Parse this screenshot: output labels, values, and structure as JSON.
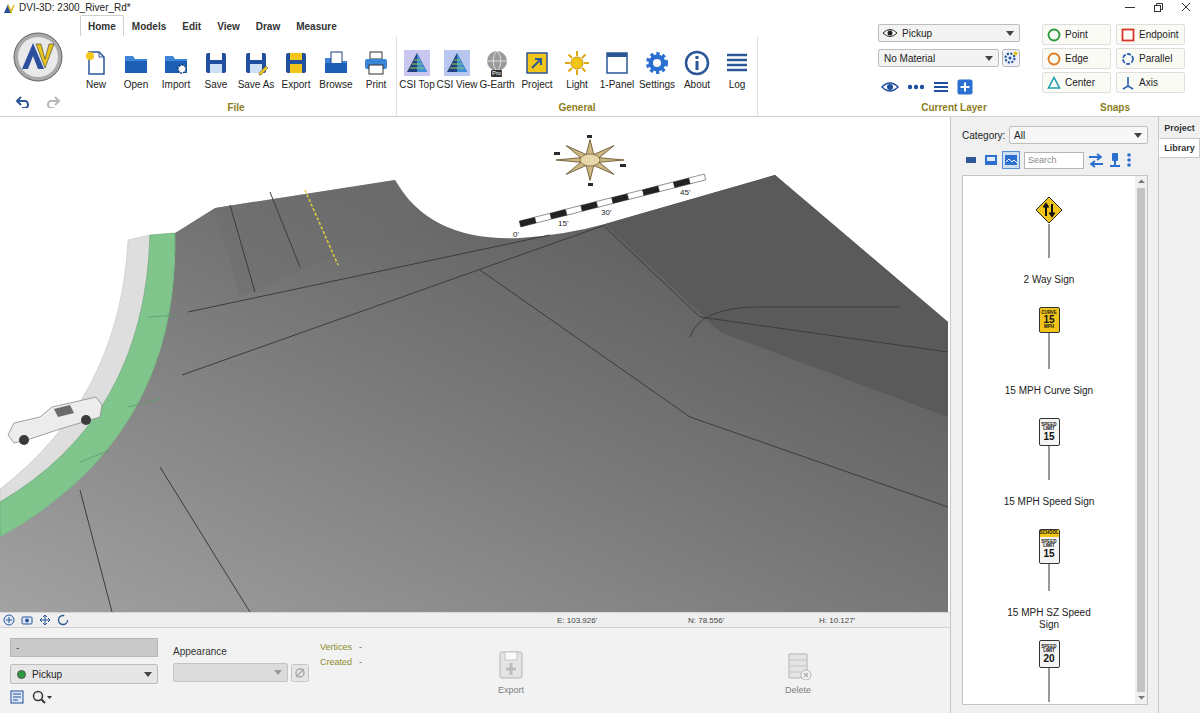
{
  "window": {
    "title": "DVI-3D: 2300_River_Rd*"
  },
  "ribbon": {
    "tabs": [
      {
        "label": "Home",
        "selected": true
      },
      {
        "label": "Models",
        "selected": false
      },
      {
        "label": "Edit",
        "selected": false
      },
      {
        "label": "View",
        "selected": false
      },
      {
        "label": "Draw",
        "selected": false
      },
      {
        "label": "Measure",
        "selected": false
      }
    ],
    "groups": [
      {
        "label": "File",
        "buttons": [
          {
            "label": "New"
          },
          {
            "label": "Open"
          },
          {
            "label": "Import"
          },
          {
            "label": "Save"
          },
          {
            "label": "Save As"
          },
          {
            "label": "Export"
          },
          {
            "label": "Browse"
          },
          {
            "label": "Print"
          }
        ]
      },
      {
        "label": "General",
        "buttons": [
          {
            "label": "CSI Top"
          },
          {
            "label": "CSI View"
          },
          {
            "label": "G-Earth",
            "badge": "Pro"
          },
          {
            "label": "Project"
          },
          {
            "label": "Light"
          },
          {
            "label": "1-Panel"
          },
          {
            "label": "Settings"
          },
          {
            "label": "About"
          },
          {
            "label": "Log"
          }
        ]
      }
    ],
    "undo_enabled": true,
    "redo_enabled": false
  },
  "current_layer": {
    "label": "Current Layer",
    "layer": "Pickup",
    "material": "No Material"
  },
  "snaps": {
    "label": "Snaps",
    "items": [
      {
        "label": "Point",
        "kind": "circle",
        "color": "#2a9a3c"
      },
      {
        "label": "Endpoint",
        "kind": "square",
        "color": "#d9362b"
      },
      {
        "label": "Edge",
        "kind": "circle",
        "color": "#e07a1f"
      },
      {
        "label": "Parallel",
        "kind": "ring",
        "color": "#2d5fb5"
      },
      {
        "label": "Center",
        "kind": "triangle",
        "color": "#1f9fb0"
      },
      {
        "label": "Axis",
        "kind": "axis",
        "color": "#2d5fb5"
      }
    ]
  },
  "viewport": {
    "scale_labels": [
      "0'",
      "15'",
      "30'",
      "45'"
    ],
    "coords": [
      {
        "text": "E: 103.926'"
      },
      {
        "text": "N: 78.556'"
      },
      {
        "text": "H: 10.127'"
      }
    ]
  },
  "properties": {
    "name_field": "-",
    "name_disabled": true,
    "layer": "Pickup",
    "layer_color": "#2a9a3c",
    "appearance_label": "Appearance",
    "appearance_disabled": true,
    "stats": [
      {
        "label": "Vertices",
        "value": "-"
      },
      {
        "label": "Created",
        "value": "-"
      }
    ],
    "actions": [
      {
        "label": "Export",
        "disabled": true
      },
      {
        "label": "Delete",
        "disabled": true
      }
    ]
  },
  "library": {
    "tabs": [
      {
        "label": "Project",
        "selected": false
      },
      {
        "label": "Library",
        "selected": true
      }
    ],
    "category_label": "Category:",
    "category": "All",
    "search_placeholder": "Search",
    "view_buttons": [
      {
        "selected": false
      },
      {
        "selected": false
      },
      {
        "selected": true
      }
    ],
    "items": [
      {
        "name": "2 Way Sign",
        "kind": "warning"
      },
      {
        "name": "15 MPH Curve Sign",
        "kind": "advisory",
        "sign": [
          "CURVE",
          "15",
          "MPH"
        ]
      },
      {
        "name": "15 MPH Speed Sign",
        "kind": "speed",
        "sign": [
          "SPEED",
          "LIMIT",
          "15"
        ]
      },
      {
        "name": "15 MPH SZ Speed Sign",
        "kind": "school",
        "sign": [
          "SCHOOL",
          "SPEED",
          "LIMIT",
          "15"
        ]
      },
      {
        "kind": "speed",
        "sign": [
          "SPEED",
          "LIMIT",
          "20"
        ]
      }
    ]
  }
}
